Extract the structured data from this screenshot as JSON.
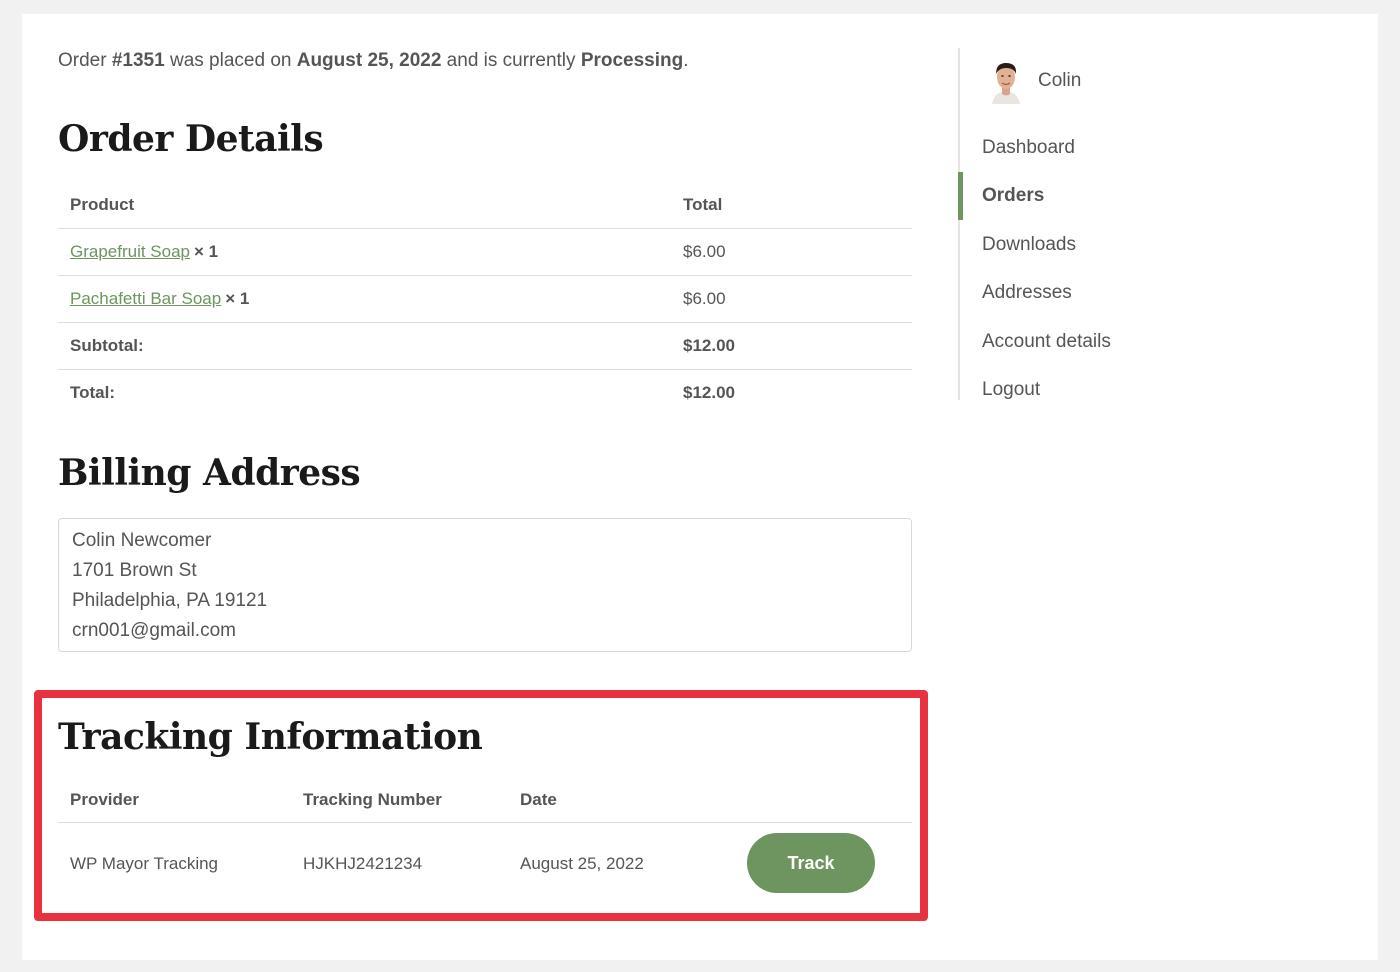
{
  "notice": {
    "prefix": "Order ",
    "order_number": "#1351",
    "middle1": " was placed on ",
    "date": "August 25, 2022",
    "middle2": " and is currently ",
    "status": "Processing",
    "suffix": "."
  },
  "order_details": {
    "title": "Order Details",
    "headers": {
      "product": "Product",
      "total": "Total"
    },
    "items": [
      {
        "name": "Grapefruit Soap",
        "qty": "× 1",
        "total": "$6.00"
      },
      {
        "name": "Pachafetti Bar Soap",
        "qty": "× 1",
        "total": "$6.00"
      }
    ],
    "subtotal_label": "Subtotal:",
    "subtotal_value": "$12.00",
    "total_label": "Total:",
    "total_value": "$12.00"
  },
  "billing": {
    "title": "Billing Address",
    "name": "Colin Newcomer",
    "street": "1701 Brown St",
    "city": "Philadelphia, PA 19121",
    "email": "crn001@gmail.com"
  },
  "tracking": {
    "title": "Tracking Information",
    "headers": {
      "provider": "Provider",
      "number": "Tracking Number",
      "date": "Date"
    },
    "row": {
      "provider": "WP Mayor Tracking",
      "number": "HJKHJ2421234",
      "date": "August 25, 2022"
    },
    "button_label": "Track",
    "highlight_color": "#e8323f"
  },
  "sidebar": {
    "username": "Colin",
    "nav": [
      {
        "label": "Dashboard",
        "active": false
      },
      {
        "label": "Orders",
        "active": true
      },
      {
        "label": "Downloads",
        "active": false
      },
      {
        "label": "Addresses",
        "active": false
      },
      {
        "label": "Account details",
        "active": false
      },
      {
        "label": "Logout",
        "active": false
      }
    ]
  },
  "colors": {
    "accent": "#6e9460",
    "text": "#555555",
    "heading": "#1a1a1a"
  }
}
